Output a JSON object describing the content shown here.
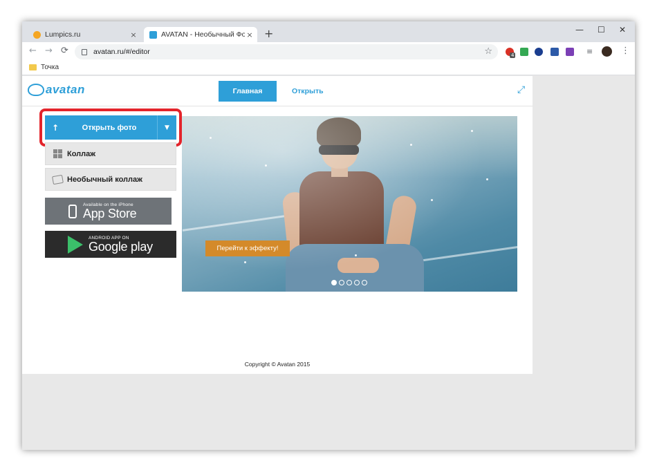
{
  "browser": {
    "tabs": [
      {
        "title": "Lumpics.ru",
        "close": "×",
        "active": false
      },
      {
        "title": "AVATAN - Необычный Фоторедактор",
        "close": "×",
        "active": true
      }
    ],
    "new_tab": "+",
    "window_controls": {
      "minimize": "—",
      "maximize": "☐",
      "close": "✕"
    },
    "nav": {
      "back": "←",
      "forward": "→",
      "reload": "⟳"
    },
    "url": "avatan.ru/#/editor",
    "bookmark_star": "☆",
    "extension_badge": "4",
    "bookmarks": [
      {
        "label": "Точка"
      }
    ],
    "menu": "⋮"
  },
  "site": {
    "logo": "avatan",
    "nav": {
      "main": "Главная",
      "open": "Открыть"
    },
    "expand_icon": "⤢"
  },
  "sidebar": {
    "open_photo": {
      "arrow": "↑",
      "label": "Открыть фото",
      "dropdown": "▼"
    },
    "collage": "Коллаж",
    "unusual_collage": "Необычный коллаж",
    "app_store": {
      "small": "Available on the iPhone",
      "big": "App Store"
    },
    "google_play": {
      "small": "ANDROID APP ON",
      "big": "Google play"
    }
  },
  "hero": {
    "effect_button": "Перейти к эффекту!",
    "slides": 5,
    "active_slide": 1
  },
  "footer": {
    "copyright": "Copyright © Avatan 2015"
  },
  "colors": {
    "accent": "#2e9fd8",
    "highlight": "#e3242b",
    "effect": "#d48a2a"
  }
}
